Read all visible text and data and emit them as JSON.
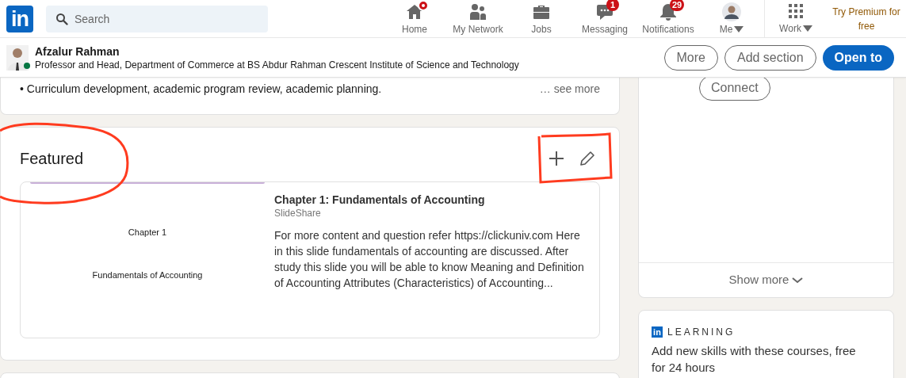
{
  "logo": "in",
  "search": {
    "placeholder": "Search"
  },
  "nav": [
    {
      "kind": "home",
      "label": "Home",
      "dot": true,
      "selected": false
    },
    {
      "kind": "network",
      "label": "My Network",
      "selected": false
    },
    {
      "kind": "jobs",
      "label": "Jobs",
      "selected": false
    },
    {
      "kind": "messaging",
      "label": "Messaging",
      "badge": "1",
      "selected": false
    },
    {
      "kind": "notifications",
      "label": "Notifications",
      "badge": "29",
      "selected": false
    },
    {
      "kind": "me",
      "label": "Me",
      "selected": false
    }
  ],
  "work": {
    "label": "Work"
  },
  "premium": "Try Premium for free",
  "profile_bar": {
    "name": "Afzalur Rahman",
    "online": true,
    "headline": "Professor and Head, Department of Commerce at BS Abdur Rahman Crescent Institute of Science and Technology",
    "buttons": [
      {
        "label": "More",
        "kind": "outline"
      },
      {
        "label": "Add section",
        "kind": "outline"
      },
      {
        "label": "Open to",
        "kind": "primary"
      }
    ]
  },
  "about": {
    "lines": [
      "• Curriculum development, academic program review, academic planning."
    ],
    "see_more": "… see more"
  },
  "featured": {
    "title": "Featured",
    "item": {
      "slide": {
        "title": "Chapter 1",
        "subtitle": "Fundamentals of Accounting"
      },
      "title": "Chapter 1: Fundamentals of Accounting",
      "source": "SlideShare",
      "description": "For more content and question refer https://clickuniv.com Here in this slide fundamentals of accounting are discussed. After study this slide you will be able to know Meaning and Definition of Accounting Attributes (Characteristics) of Accounting..."
    }
  },
  "sidebar": {
    "connect": "Connect",
    "show_more": "Show more",
    "learning": {
      "logo": "in",
      "label": "LEARNING",
      "text": "Add new skills with these courses, free for 24 hours"
    }
  }
}
